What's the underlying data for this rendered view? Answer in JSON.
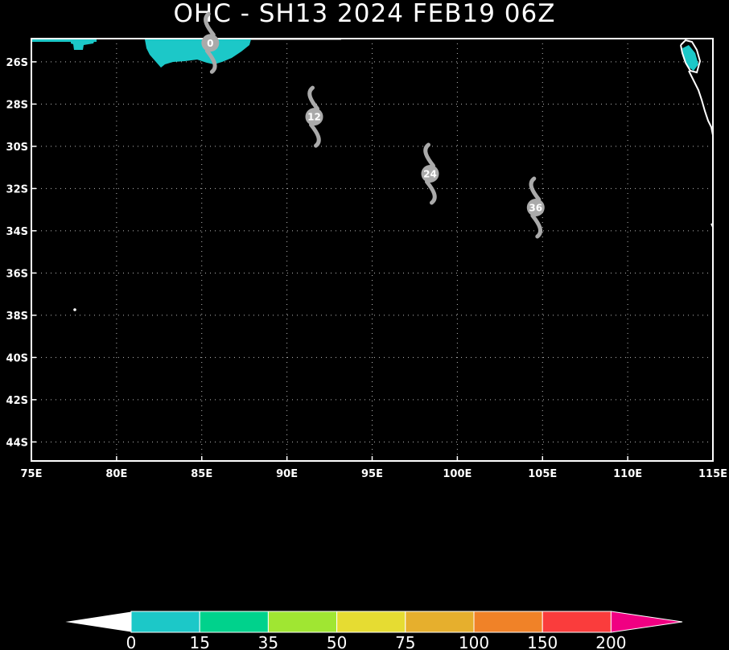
{
  "title": "OHC - SH13 2024 FEB19 06Z",
  "map": {
    "lat_labels": [
      "26S",
      "28S",
      "30S",
      "32S",
      "34S",
      "36S",
      "38S",
      "40S",
      "42S",
      "44S"
    ],
    "lon_labels": [
      "75E",
      "80E",
      "85E",
      "90E",
      "95E",
      "100E",
      "105E",
      "110E",
      "115E"
    ],
    "lon_range": [
      75,
      115
    ],
    "lat_range_deg_south": [
      24.9,
      44.9
    ],
    "grid": true,
    "colors": {
      "background": "#000000",
      "frame": "#ffffff",
      "grid": "#bbbbbb",
      "ohc_shallow": "#1cc8c8",
      "coast": "#ffffff",
      "track_symbol": "#aaaaaa"
    }
  },
  "track": [
    {
      "hour_label": "0",
      "lon": 85.5,
      "lat": -25.1
    },
    {
      "hour_label": "12",
      "lon": 91.6,
      "lat": -28.6
    },
    {
      "hour_label": "24",
      "lon": 98.4,
      "lat": -31.3
    },
    {
      "hour_label": "36",
      "lon": 104.6,
      "lat": -32.9
    }
  ],
  "colorbar": {
    "labels": [
      "0",
      "15",
      "35",
      "50",
      "75",
      "100",
      "150",
      "200"
    ],
    "colors": [
      "#1cc8c8",
      "#00d28c",
      "#a0e632",
      "#e6dc32",
      "#e6af2d",
      "#f08228",
      "#fa3c3c",
      "#f00082"
    ],
    "min_end_color": "#ffffff",
    "max_end_color": "#f00082"
  }
}
